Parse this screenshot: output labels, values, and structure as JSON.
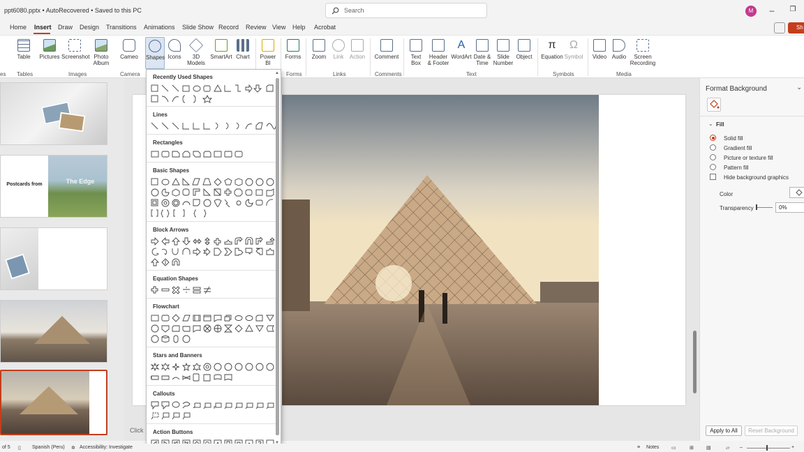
{
  "titlebar": {
    "title": "ppt6080.pptx  •  AutoRecovered  •  Saved to this PC",
    "search_placeholder": "Search",
    "avatar_initial": "M"
  },
  "menu": {
    "tabs": [
      "Home",
      "Insert",
      "Draw",
      "Design",
      "Transitions",
      "Animations",
      "Slide Show",
      "Record",
      "Review",
      "View",
      "Help",
      "Acrobat"
    ],
    "active": "Insert",
    "share_label": "Sh"
  },
  "ribbon": {
    "buttons": [
      {
        "label": "Table",
        "sub": ""
      },
      {
        "label": "Pictures",
        "sub": ""
      },
      {
        "label": "Screenshot",
        "sub": ""
      },
      {
        "label": "Photo",
        "sub": "Album"
      },
      {
        "label": "Cameo",
        "sub": ""
      },
      {
        "label": "Shapes",
        "sub": ""
      },
      {
        "label": "Icons",
        "sub": ""
      },
      {
        "label": "3D",
        "sub": "Models"
      },
      {
        "label": "SmartArt",
        "sub": ""
      },
      {
        "label": "Chart",
        "sub": ""
      },
      {
        "label": "Power",
        "sub": "BI"
      },
      {
        "label": "Forms",
        "sub": ""
      },
      {
        "label": "Zoom",
        "sub": ""
      },
      {
        "label": "Link",
        "sub": ""
      },
      {
        "label": "Action",
        "sub": ""
      },
      {
        "label": "Comment",
        "sub": ""
      },
      {
        "label": "Text",
        "sub": "Box"
      },
      {
        "label": "Header",
        "sub": "& Footer"
      },
      {
        "label": "WordArt",
        "sub": ""
      },
      {
        "label": "Date &",
        "sub": "Time"
      },
      {
        "label": "Slide",
        "sub": "Number"
      },
      {
        "label": "Object",
        "sub": ""
      },
      {
        "label": "Equation",
        "sub": ""
      },
      {
        "label": "Symbol",
        "sub": ""
      },
      {
        "label": "Video",
        "sub": ""
      },
      {
        "label": "Audio",
        "sub": ""
      },
      {
        "label": "Screen",
        "sub": "Recording"
      }
    ],
    "groups": [
      "es",
      "Tables",
      "Images",
      "Camera",
      "Forms",
      "Links",
      "Comments",
      "Text",
      "Symbols",
      "Media"
    ]
  },
  "shapes_menu": {
    "sections": [
      "Recently Used Shapes",
      "Lines",
      "Rectangles",
      "Basic Shapes",
      "Block Arrows",
      "Equation Shapes",
      "Flowchart",
      "Stars and Banners",
      "Callouts",
      "Action Buttons"
    ]
  },
  "thumbnails": {
    "slide2_title": "Postcards from",
    "slide2_overlay": "The Edge"
  },
  "format_background": {
    "title": "Format Background",
    "fill_header": "Fill",
    "options": [
      {
        "label": "Solid fill",
        "selected": true
      },
      {
        "label": "Gradient fill",
        "selected": false
      },
      {
        "label": "Picture or texture fill",
        "selected": false
      },
      {
        "label": "Pattern fill",
        "selected": false
      }
    ],
    "hide_graphics_label": "Hide background graphics",
    "color_label": "Color",
    "transparency_label": "Transparency",
    "transparency_value": "0%",
    "apply_all": "Apply to All",
    "reset": "Reset Background"
  },
  "editor": {
    "notes_hint": "Click"
  },
  "statusbar": {
    "slide_count": "of 5",
    "language": "Spanish (Peru)",
    "accessibility": "Accessibility: Investigate",
    "notes": "Notes"
  },
  "colors": {
    "accent": "#c43e1c",
    "ribbon_bg": "#ffffff",
    "pane_bg": "#e9e9e9"
  }
}
